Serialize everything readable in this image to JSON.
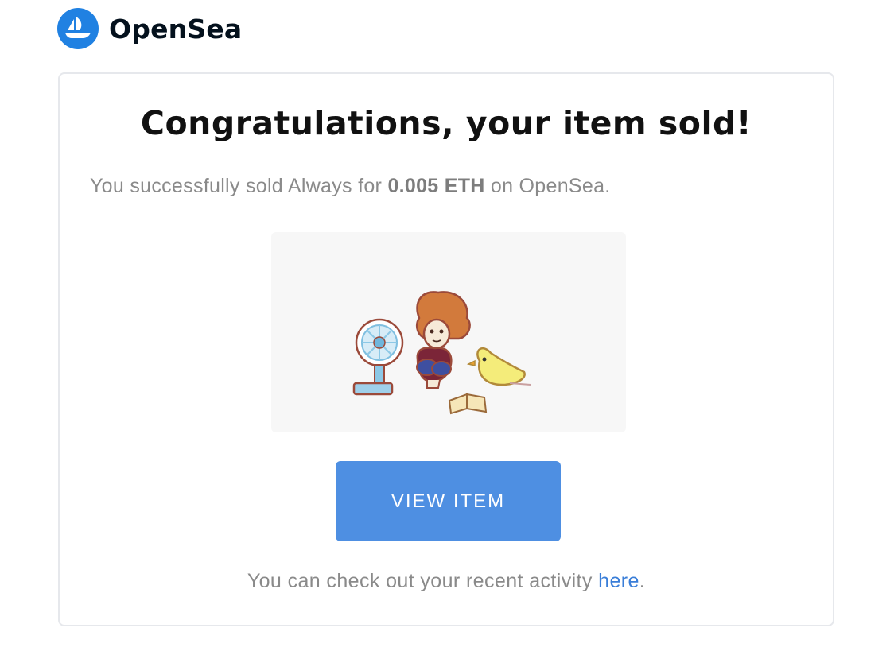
{
  "brand": {
    "name": "OpenSea",
    "logo_icon": "opensea-ship-icon",
    "color": "#2081e2"
  },
  "email": {
    "title": "Congratulations, your item sold!",
    "sale_prefix": "You successfully sold Always for ",
    "price": "0.005 ETH",
    "sale_suffix": " on OpenSea.",
    "item_image_icon": "nft-artwork-fan-character-bird-book",
    "cta_label": "VIEW ITEM",
    "cta_color": "#4e8fe2",
    "activity_prefix": "You can check out your recent activity ",
    "activity_link": "here",
    "activity_suffix": "."
  }
}
